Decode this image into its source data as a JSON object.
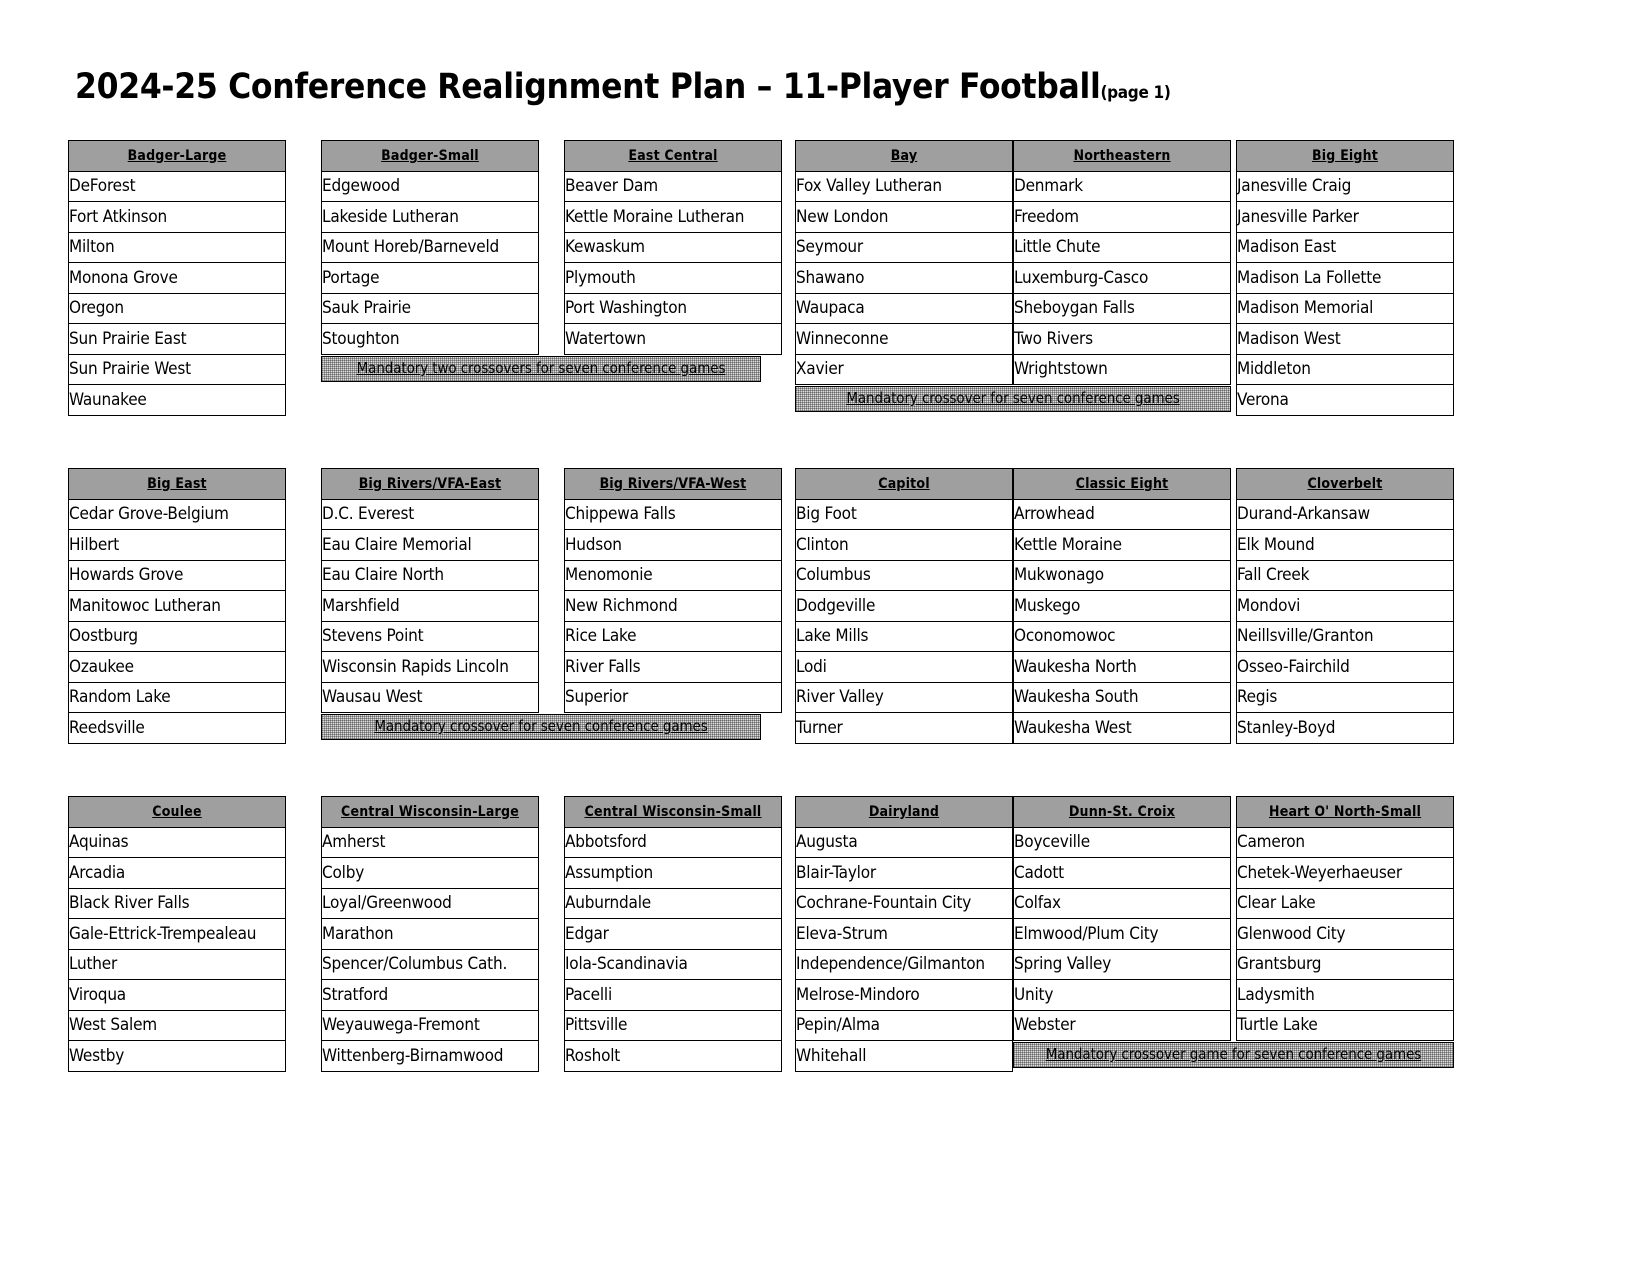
{
  "page": {
    "title_main": "2024-25 Conference Realignment Plan – 11-Player Football",
    "title_sub": "(page 1)"
  },
  "notes": {
    "badger_small_east_central": "Mandatory two crossovers for seven conference games",
    "bay_northeastern": "Mandatory crossover for seven conference games",
    "big_rivers": "Mandatory crossover for seven conference games",
    "dunn_heart": "Mandatory crossover game for seven conference games"
  },
  "bands": [
    {
      "conferences": [
        {
          "name": "Badger-Large",
          "teams": [
            "DeForest",
            "Fort Atkinson",
            "Milton",
            "Monona Grove",
            "Oregon",
            "Sun Prairie East",
            "Sun Prairie West",
            "Waunakee"
          ]
        },
        {
          "name": "Badger-Small",
          "teams": [
            "Edgewood",
            "Lakeside Lutheran",
            "Mount Horeb/Barneveld",
            "Portage",
            "Sauk Prairie",
            "Stoughton"
          ]
        },
        {
          "name": "East Central",
          "teams": [
            "Beaver Dam",
            "Kettle Moraine Lutheran",
            "Kewaskum",
            "Plymouth",
            "Port Washington",
            "Watertown"
          ]
        },
        {
          "name": "Bay",
          "teams": [
            "Fox Valley Lutheran",
            "New London",
            "Seymour",
            "Shawano",
            "Waupaca",
            "Winneconne",
            "Xavier"
          ]
        },
        {
          "name": "Northeastern",
          "teams": [
            "Denmark",
            "Freedom",
            "Little Chute",
            "Luxemburg-Casco",
            "Sheboygan Falls",
            "Two Rivers",
            "Wrightstown"
          ]
        },
        {
          "name": "Big Eight",
          "teams": [
            "Janesville Craig",
            "Janesville Parker",
            "Madison East",
            "Madison La Follette",
            "Madison Memorial",
            "Madison West",
            "Middleton",
            "Verona"
          ]
        }
      ]
    },
    {
      "conferences": [
        {
          "name": "Big East",
          "teams": [
            "Cedar Grove-Belgium",
            "Hilbert",
            "Howards Grove",
            "Manitowoc Lutheran",
            "Oostburg",
            "Ozaukee",
            "Random Lake",
            "Reedsville"
          ]
        },
        {
          "name": "Big Rivers/VFA-East",
          "teams": [
            "D.C. Everest",
            "Eau Claire Memorial",
            "Eau Claire North",
            "Marshfield",
            "Stevens Point",
            "Wisconsin Rapids Lincoln",
            "Wausau West"
          ]
        },
        {
          "name": "Big Rivers/VFA-West",
          "teams": [
            "Chippewa Falls",
            "Hudson",
            "Menomonie",
            "New Richmond",
            "Rice Lake",
            "River Falls",
            "Superior"
          ]
        },
        {
          "name": "Capitol",
          "teams": [
            "Big Foot",
            "Clinton",
            "Columbus",
            "Dodgeville",
            "Lake Mills",
            "Lodi",
            "River Valley",
            "Turner"
          ]
        },
        {
          "name": "Classic Eight",
          "teams": [
            "Arrowhead",
            "Kettle Moraine",
            "Mukwonago",
            "Muskego",
            "Oconomowoc",
            "Waukesha North",
            "Waukesha South",
            "Waukesha West"
          ]
        },
        {
          "name": "Cloverbelt",
          "teams": [
            "Durand-Arkansaw",
            "Elk Mound",
            "Fall Creek",
            "Mondovi",
            "Neillsville/Granton",
            "Osseo-Fairchild",
            "Regis",
            "Stanley-Boyd"
          ]
        }
      ]
    },
    {
      "conferences": [
        {
          "name": "Coulee",
          "teams": [
            "Aquinas",
            "Arcadia",
            "Black River Falls",
            "Gale-Ettrick-Trempealeau",
            "Luther",
            "Viroqua",
            "West Salem",
            "Westby"
          ]
        },
        {
          "name": "Central Wisconsin-Large",
          "teams": [
            "Amherst",
            "Colby",
            "Loyal/Greenwood",
            "Marathon",
            "Spencer/Columbus Cath.",
            "Stratford",
            "Weyauwega-Fremont",
            "Wittenberg-Birnamwood"
          ]
        },
        {
          "name": "Central Wisconsin-Small",
          "teams": [
            "Abbotsford",
            "Assumption",
            "Auburndale",
            "Edgar",
            "Iola-Scandinavia",
            "Pacelli",
            "Pittsville",
            "Rosholt"
          ]
        },
        {
          "name": "Dairyland",
          "teams": [
            "Augusta",
            "Blair-Taylor",
            "Cochrane-Fountain City",
            "Eleva-Strum",
            "Independence/Gilmanton",
            "Melrose-Mindoro",
            "Pepin/Alma",
            "Whitehall"
          ]
        },
        {
          "name": "Dunn-St. Croix",
          "teams": [
            "Boyceville",
            "Cadott",
            "Colfax",
            "Elmwood/Plum City",
            "Spring Valley",
            "Unity",
            "Webster"
          ]
        },
        {
          "name": "Heart O' North-Small",
          "teams": [
            "Cameron",
            "Chetek-Weyerhaeuser",
            "Clear Lake",
            "Glenwood City",
            "Grantsburg",
            "Ladysmith",
            "Turtle Lake"
          ]
        }
      ]
    }
  ]
}
